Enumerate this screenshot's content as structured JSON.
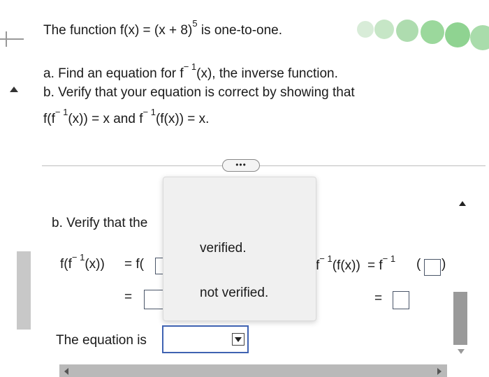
{
  "question": {
    "intro_prefix": "The function f(x) = (x + 8)",
    "intro_exponent": "5",
    "intro_suffix": " is one-to-one.",
    "part_a_prefix": "a. Find an equation for f",
    "part_a_sup": "− 1",
    "part_a_suffix": "(x), the inverse function.",
    "part_b": "b. Verify that your equation is correct by showing that",
    "verify_line": {
      "lhs_prefix": "f(f",
      "lhs_sup": "− 1",
      "lhs_suffix": "(x)) = x and f",
      "rhs_sup": "− 1",
      "rhs_suffix": "(f(x)) = x."
    }
  },
  "more_button": "•••",
  "answer": {
    "part_b_label": "b. Verify that the",
    "lhs": {
      "expr_prefix": "f(f",
      "expr_sup": "− 1",
      "expr_suffix": "(x))",
      "equals_prefix": "= f(",
      "second_equals": "="
    },
    "rhs": {
      "expr_prefix": "f",
      "expr_sup": "− 1",
      "expr_suffix": "(f(x))",
      "equals_prefix": "= f",
      "equals_sup": "− 1",
      "second_equals": "="
    },
    "equation_label": "The equation is",
    "select_value": ""
  },
  "dropdown": {
    "options": [
      "verified.",
      "not verified."
    ]
  },
  "colors": {
    "select_border": "#3f62b2",
    "popup_bg": "#f0f0f0",
    "scroll_thumb": "#9a9a9a"
  }
}
